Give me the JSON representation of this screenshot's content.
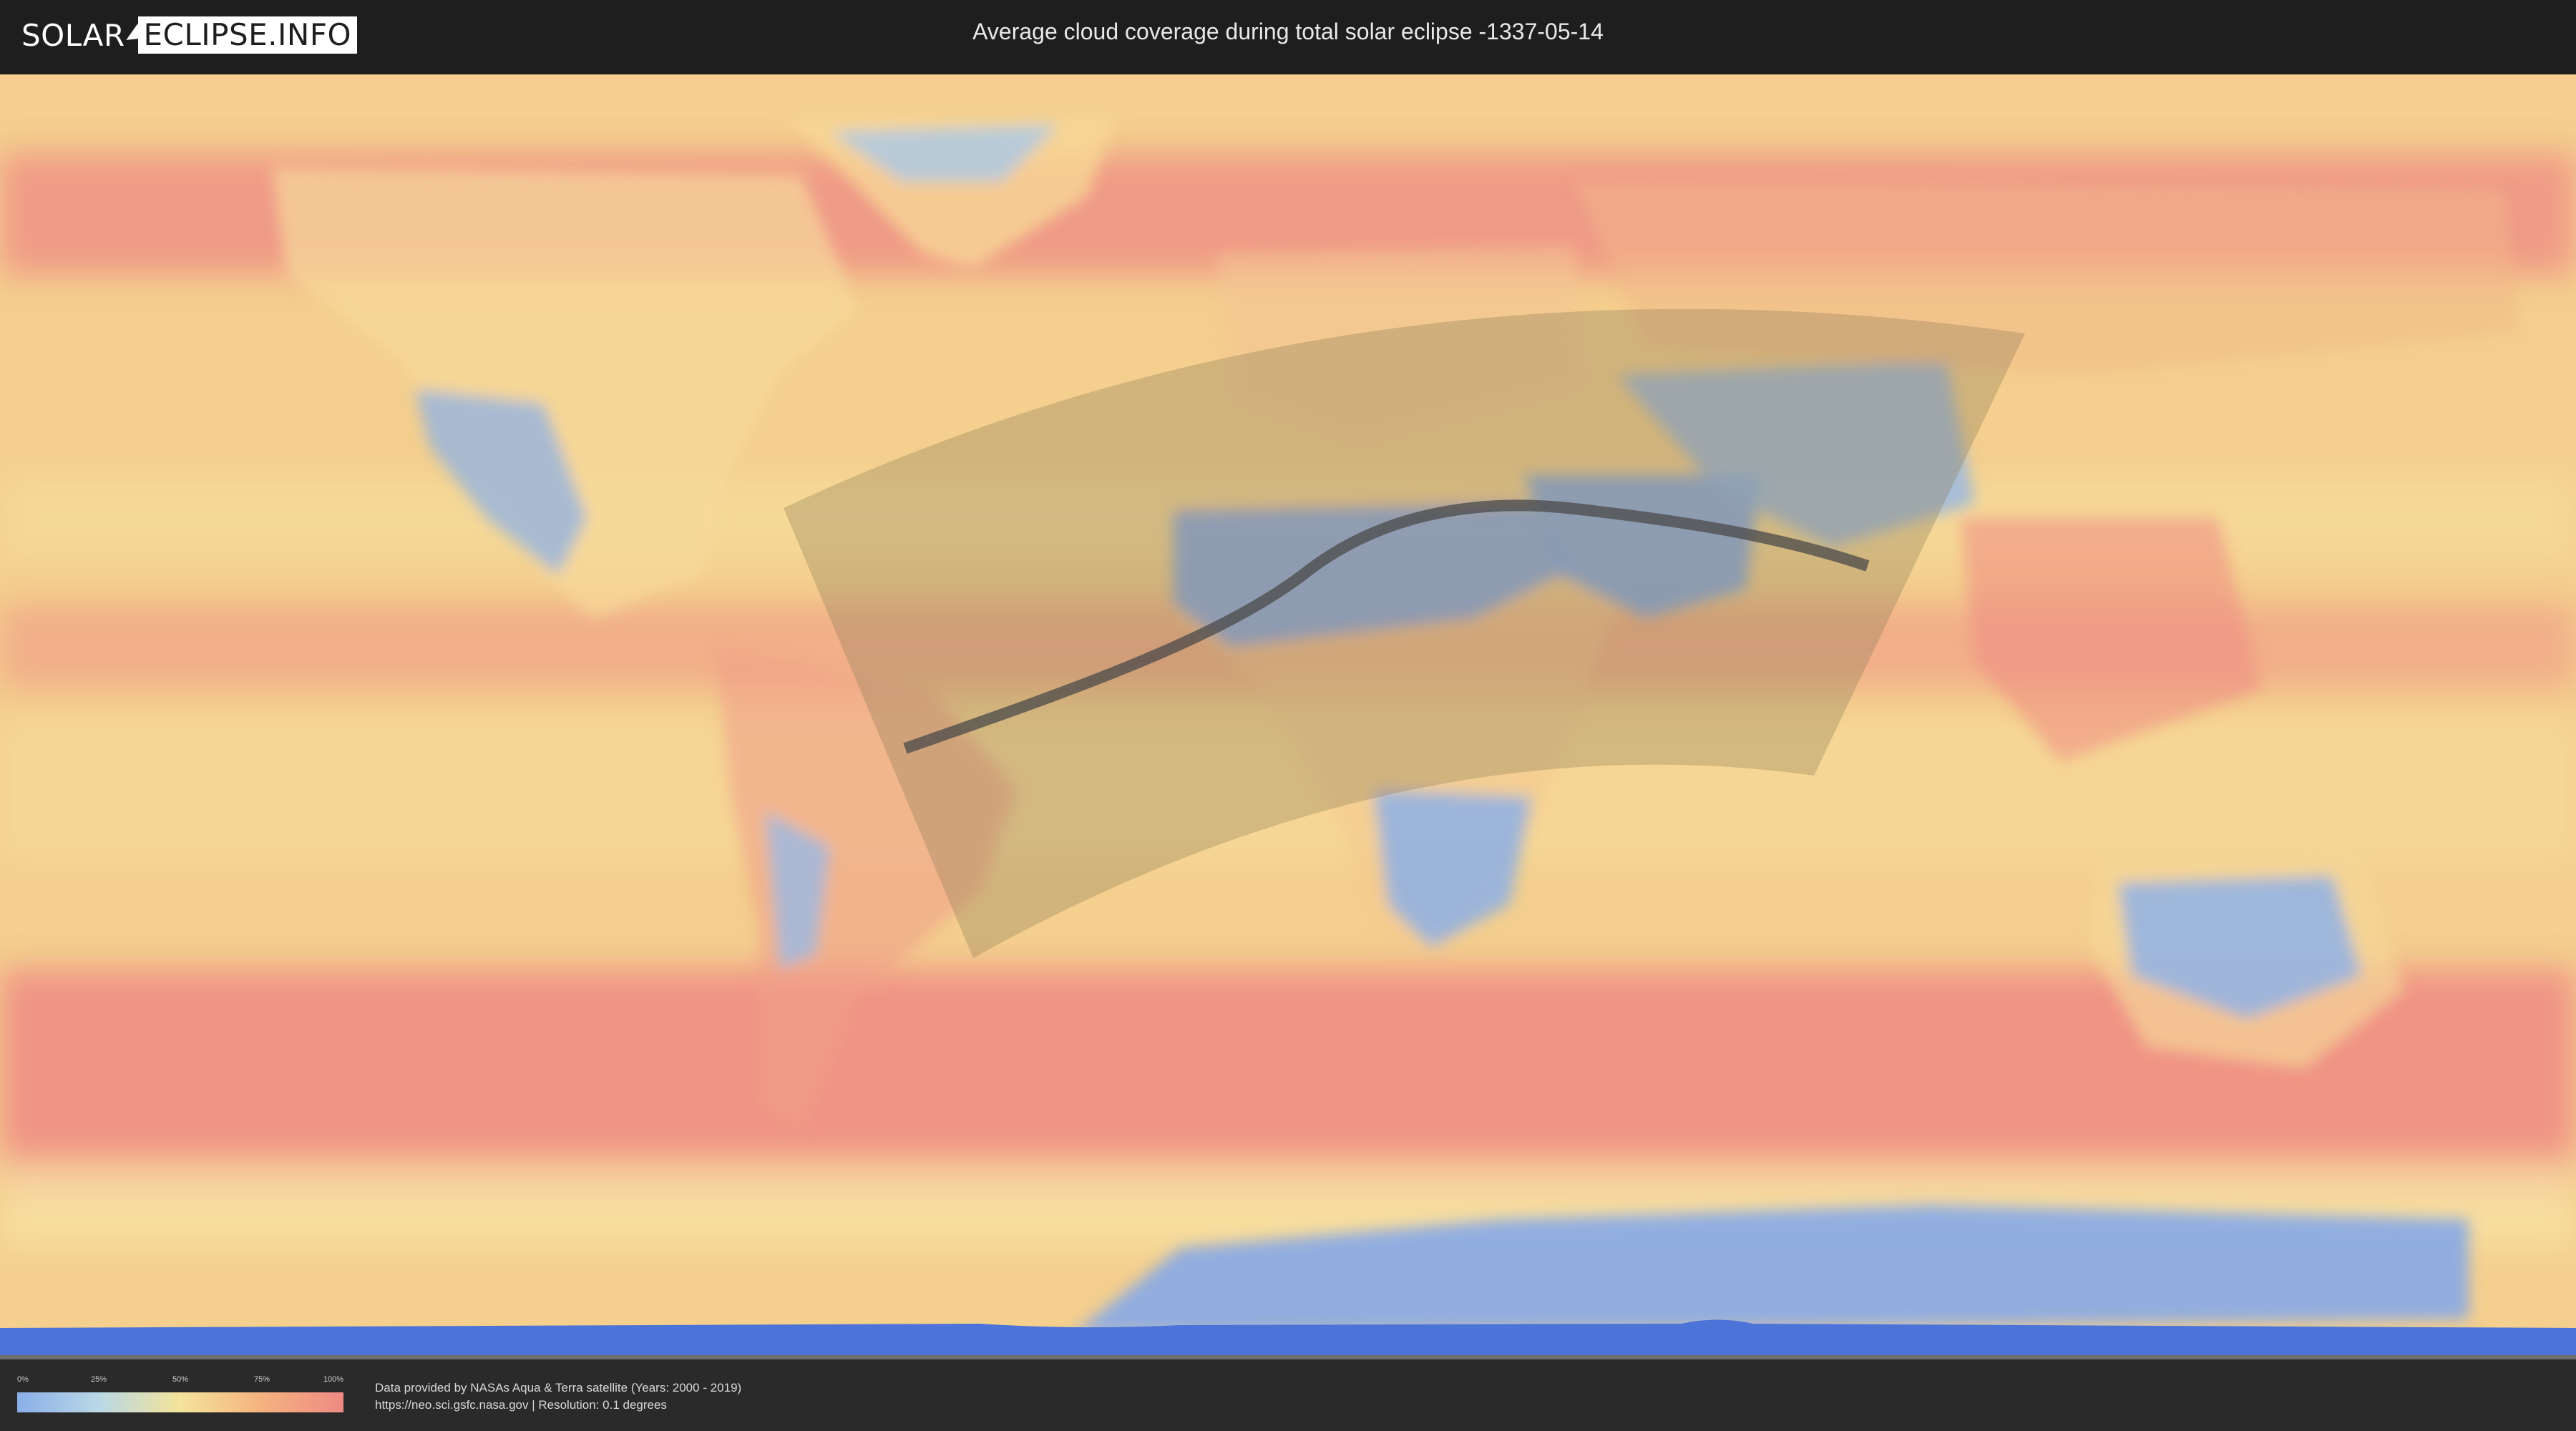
{
  "header": {
    "logo_left": "SOLAR",
    "logo_right": "ECLIPSE.INFO",
    "title": "Average cloud coverage during total solar eclipse -1337-05-14"
  },
  "legend": {
    "ticks": [
      "0%",
      "25%",
      "50%",
      "75%",
      "100%"
    ],
    "color_low": "#8aaee8",
    "color_high": "#ee8a84"
  },
  "footer": {
    "credit_line1": "Data provided by NASAs Aqua & Terra satellite (Years: 2000 - 2019)",
    "credit_line2": "https://neo.sci.gsfc.nasa.gov | Resolution: 0.1 degrees"
  },
  "colors": {
    "clear": "#8aaee8",
    "low": "#b9d8e6",
    "mid": "#f4e39a",
    "high": "#f4b27f",
    "cloudy": "#ee8a84",
    "eclipse_zone": "#8a7a55",
    "eclipse_path": "#4a4a4a"
  }
}
